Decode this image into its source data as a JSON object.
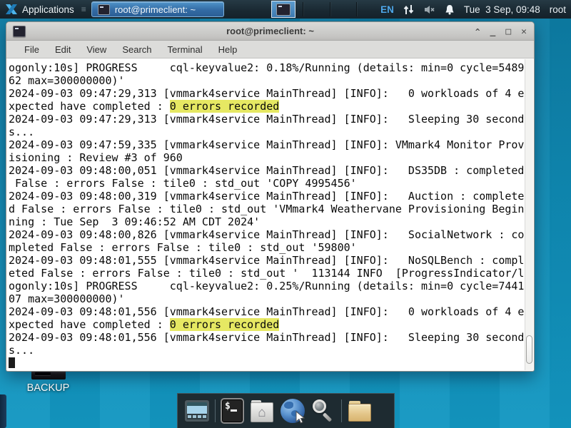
{
  "panel": {
    "applications_label": "Applications",
    "task_button_label": "root@primeclient: ~",
    "language_indicator": "EN",
    "clock": "Tue  3 Sep, 09:48",
    "user": "root"
  },
  "window": {
    "title": "root@primeclient: ~",
    "menu": [
      "File",
      "Edit",
      "View",
      "Search",
      "Terminal",
      "Help"
    ],
    "controls": {
      "shade": "^",
      "minimize": "_",
      "maximize": "□",
      "close": "✕"
    }
  },
  "terminal": {
    "highlight_color": "#e6e863",
    "lines": [
      [
        {
          "t": "ogonly:10s] PROGRESS     cql-keyvalue2: 0.18%/Running (details: min=0 cycle=5489"
        }
      ],
      [
        {
          "t": "62 max=300000000)'"
        }
      ],
      [
        {
          "t": "2024-09-03 09:47:29,313 [vmmark4service MainThread] [INFO]:   0 workloads of 4 e"
        }
      ],
      [
        {
          "t": "xpected have completed : "
        },
        {
          "t": "0 errors recorded",
          "h": true
        }
      ],
      [
        {
          "t": "2024-09-03 09:47:29,313 [vmmark4service MainThread] [INFO]:   Sleeping 30 second"
        }
      ],
      [
        {
          "t": "s..."
        }
      ],
      [
        {
          "t": "2024-09-03 09:47:59,335 [vmmark4service MainThread] [INFO]: VMmark4 Monitor Prov"
        }
      ],
      [
        {
          "t": "isioning : Review #3 of 960"
        }
      ],
      [
        {
          "t": "2024-09-03 09:48:00,051 [vmmark4service MainThread] [INFO]:   DS35DB : completed"
        }
      ],
      [
        {
          "t": " False : errors False : tile0 : std_out 'COPY 4995456'"
        }
      ],
      [
        {
          "t": "2024-09-03 09:48:00,319 [vmmark4service MainThread] [INFO]:   Auction : complete"
        }
      ],
      [
        {
          "t": "d False : errors False : tile0 : std_out 'VMmark4 Weathervane Provisioning Begin"
        }
      ],
      [
        {
          "t": "ning : Tue Sep  3 09:46:52 AM CDT 2024'"
        }
      ],
      [
        {
          "t": "2024-09-03 09:48:00,826 [vmmark4service MainThread] [INFO]:   SocialNetwork : co"
        }
      ],
      [
        {
          "t": "mpleted False : errors False : tile0 : std_out '59800'"
        }
      ],
      [
        {
          "t": "2024-09-03 09:48:01,555 [vmmark4service MainThread] [INFO]:   NoSQLBench : compl"
        }
      ],
      [
        {
          "t": "eted False : errors False : tile0 : std_out '  113144 INFO  [ProgressIndicator/l"
        }
      ],
      [
        {
          "t": "ogonly:10s] PROGRESS     cql-keyvalue2: 0.25%/Running (details: min=0 cycle=7441"
        }
      ],
      [
        {
          "t": "07 max=300000000)'"
        }
      ],
      [
        {
          "t": "2024-09-03 09:48:01,556 [vmmark4service MainThread] [INFO]:   0 workloads of 4 e"
        }
      ],
      [
        {
          "t": "xpected have completed : "
        },
        {
          "t": "0 errors recorded",
          "h": true
        }
      ],
      [
        {
          "t": "2024-09-03 09:48:01,556 [vmmark4service MainThread] [INFO]:   Sleeping 30 second"
        }
      ],
      [
        {
          "t": "s..."
        }
      ],
      [
        {
          "cursor": true
        }
      ]
    ]
  },
  "desktop": {
    "backup_label": "BACKUP"
  },
  "dock": {
    "items": [
      "show-desktop-icon",
      "terminal-icon",
      "file-manager-icon",
      "web-browser-icon",
      "search-icon",
      "folder-icon"
    ]
  },
  "colors": {
    "desktop_teal": "#0f8ab3",
    "panel_dark": "#192831",
    "task_button_blue": "#336ba4",
    "language_blue": "#4da6e8",
    "terminal_bg": "#ffffff",
    "terminal_text": "#0a0a0a",
    "highlight_yellow": "#e6e863",
    "titlebar_gray": "#c9c8c6",
    "dock_bg": "#1e2b31"
  }
}
